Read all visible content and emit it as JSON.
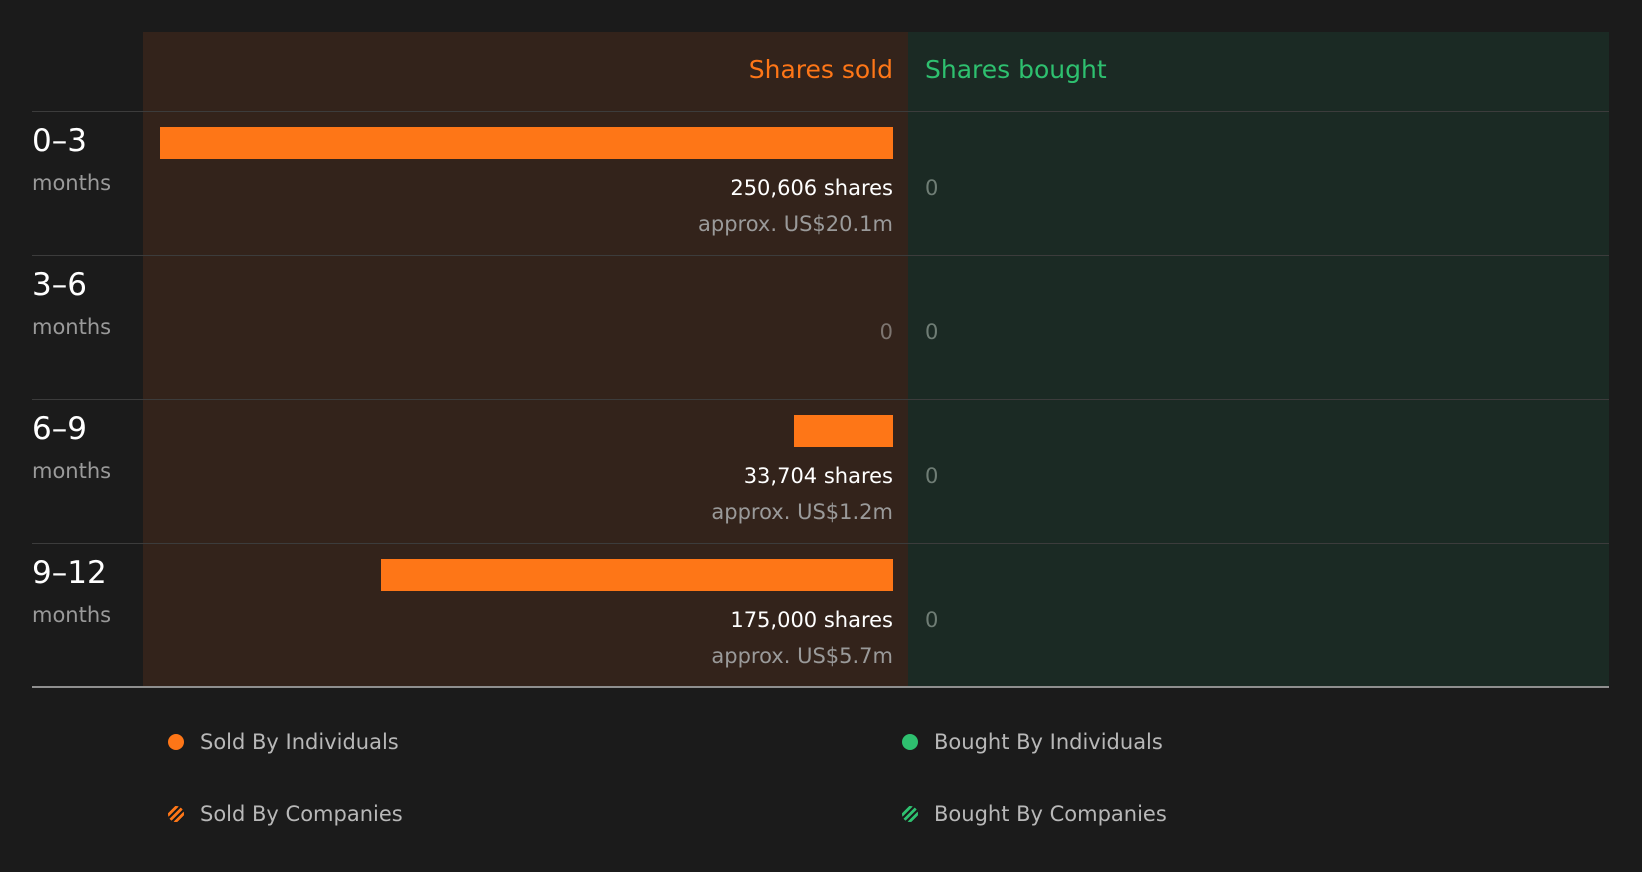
{
  "colors": {
    "sold": "#fe7617",
    "bought": "#2ec06f",
    "sold_panel": "#33231b",
    "bought_panel": "#1b2a24"
  },
  "headers": {
    "sold": "Shares sold",
    "bought": "Shares bought"
  },
  "chart_data": {
    "type": "bar",
    "categories": [
      "0–3",
      "3–6",
      "6–9",
      "9–12"
    ],
    "category_unit": "months",
    "sold": {
      "shares": [
        250606,
        0,
        33704,
        175000
      ],
      "shares_label": [
        "250,606 shares",
        "0",
        "33,704 shares",
        "175,000 shares"
      ],
      "approx_label": [
        "approx. US$20.1m",
        "",
        "approx. US$1.2m",
        "approx. US$5.7m"
      ]
    },
    "bought": {
      "shares": [
        0,
        0,
        0,
        0
      ],
      "shares_label": [
        "0",
        "0",
        "0",
        "0"
      ]
    },
    "legend": [
      {
        "label": "Sold By Individuals",
        "pattern": "solid",
        "side": "sold"
      },
      {
        "label": "Bought By Individuals",
        "pattern": "solid",
        "side": "bought"
      },
      {
        "label": "Sold By Companies",
        "pattern": "striped",
        "side": "sold"
      },
      {
        "label": "Bought By Companies",
        "pattern": "striped",
        "side": "bought"
      }
    ]
  }
}
